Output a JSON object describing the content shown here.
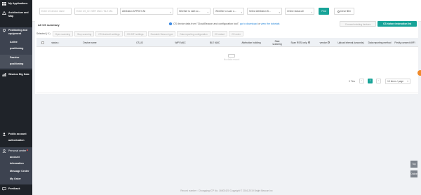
{
  "sidebar": {
    "items": [
      {
        "id": "apps",
        "label": [
          "My Applications"
        ],
        "icon": "grid-icon"
      },
      {
        "id": "arch",
        "label": [
          "Architecture and",
          "Map"
        ],
        "icon": "architecture-icon"
      },
      {
        "id": "pos",
        "label": [
          "Positioning and",
          "equipment"
        ],
        "icon": "location-pin-icon"
      },
      {
        "id": "bigdata",
        "label": [
          "Wisdom Big Data"
        ],
        "icon": "chart-icon"
      },
      {
        "id": "public",
        "label": [
          "Public account",
          "authorization"
        ],
        "icon": "user-icon"
      },
      {
        "id": "personal",
        "label": [
          "Personal center"
        ],
        "icon": "person-icon"
      },
      {
        "id": "feedback",
        "label": [
          "Feedback"
        ],
        "icon": "message-icon"
      }
    ],
    "pos_sub": [
      {
        "label": [
          "Active",
          "positioning"
        ],
        "selected": false
      },
      {
        "label": [
          "Passive",
          "positioning"
        ],
        "selected": true
      }
    ],
    "personal_sub": [
      {
        "label": [
          "account",
          "information"
        ]
      },
      {
        "label": [
          "Message Center"
        ]
      },
      {
        "label": [
          "My Order"
        ]
      }
    ]
  },
  "topbar": {
    "search_name_placeholder": "Enter CS device name",
    "search_id_placeholder": "Enter CS_ID / WIFI MAC / BLE MA",
    "attribution_select": "Attribution APPKEY:All",
    "whether_start": "Whether to start sc...",
    "whether_scan": "Whether to scan o...",
    "select_attribution": "Select Attribution B...",
    "online_status": "Online status:all",
    "find_label": "Find",
    "clear_label": "Clear filter"
  },
  "panel": {
    "title": "All CS summary",
    "info_prefix": "CS device data from \"CloudBeacon and configuration tool\",",
    "info_link1": "go to download",
    "info_mid": "or",
    "info_link2": "view the tutorials",
    "connect_btn": "Connect existing devices",
    "history_btn": "CS history instruction list",
    "selected_label": "Selected ( 0 )",
    "filter_buttons": [
      "Open scanning",
      "Stop scanning",
      "CS bluetooth settings",
      "CS WIFI settings",
      "Scanable Beacon type",
      "Data reporting configuration",
      "CS restart",
      "CS order"
    ],
    "columns": [
      "",
      "status ↕",
      "Device name",
      "CS_ID",
      "WIFI MAC",
      "BLE MAC",
      "Attribution building",
      "Start scanning",
      "Scan RSSI only",
      "version",
      "Upload interval (seconds)",
      "Data reporting method",
      "Firstly connect WIFI"
    ],
    "empty_text": "No data record"
  },
  "pagination": {
    "total": "0 Ties",
    "prev": "‹",
    "current_page": "1",
    "next": "›",
    "page_size": "10 items / page"
  },
  "footer": "Record number : Chongqing ICP No. 16003420 Copyright © 2016-2019 Bright Beacon Inc",
  "side_tools": {
    "top": "Top",
    "service": "Online"
  },
  "colors": {
    "sidebar_bg": "#1f2329",
    "accent": "#17a398",
    "link": "#1a7fd6"
  }
}
